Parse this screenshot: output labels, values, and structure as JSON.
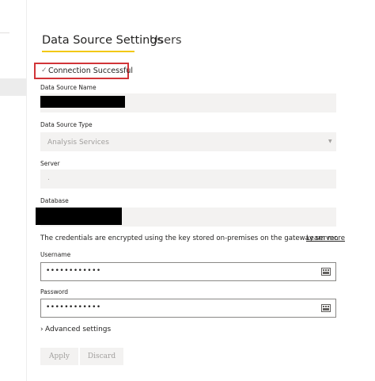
{
  "tabs": [
    {
      "label": "Data Source Settings",
      "active": true
    },
    {
      "label": "Users",
      "active": false
    }
  ],
  "status": {
    "icon": "check-icon",
    "text": "Connection Successful"
  },
  "fields": {
    "data_source_name": {
      "label": "Data Source Name",
      "value_redacted": true
    },
    "data_source_type": {
      "label": "Data Source Type",
      "value": "Analysis Services"
    },
    "server": {
      "label": "Server",
      "value": "."
    },
    "database": {
      "label": "Database",
      "value_redacted": true
    }
  },
  "credentials_info": {
    "text": "The credentials are encrypted using the key stored on-premises on the gateway server.",
    "link": "Learn more"
  },
  "username": {
    "label": "Username",
    "value": "••••••••••••"
  },
  "password": {
    "label": "Password",
    "value": "••••••••••••"
  },
  "advanced": {
    "label": "Advanced settings",
    "chevron": "›"
  },
  "buttons": {
    "apply": "Apply",
    "discard": "Discard"
  },
  "colors": {
    "accent_tab": "#f2c811",
    "status_border": "#d13438"
  }
}
